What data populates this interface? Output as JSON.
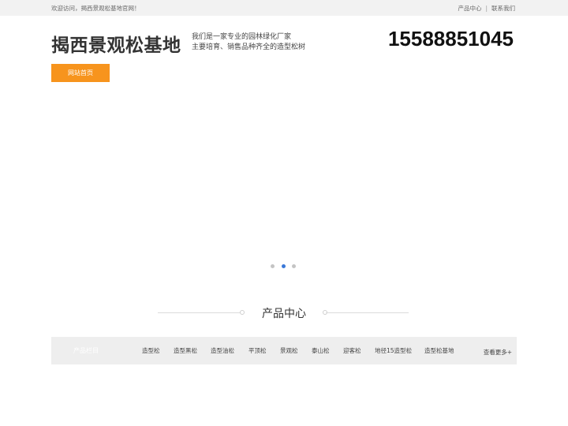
{
  "topbar": {
    "welcome": "欢迎访问，揭西景观松基地官网！",
    "link_products": "产品中心",
    "separator": "|",
    "link_contact": "联系我们"
  },
  "header": {
    "title": "揭西景观松基地",
    "slogan_line1": "我们是一家专业的园林绿化厂家",
    "slogan_line2": "主要培育、销售品种齐全的造型松树",
    "phone": "15588851045"
  },
  "nav": {
    "home": "网站首页"
  },
  "banner": {
    "slides": 3,
    "active_slide": 2
  },
  "products": {
    "section_title": "产品中心",
    "category_header": "产品栏目",
    "categories": [
      "造型松",
      "造型黑松",
      "造型油松",
      "平顶松",
      "景观松",
      "泰山松",
      "迎客松",
      "地径15造型松",
      "造型松基地"
    ],
    "more": "查看更多+"
  },
  "colors": {
    "accent": "#f7941d",
    "active_dot": "#3a78d8"
  }
}
